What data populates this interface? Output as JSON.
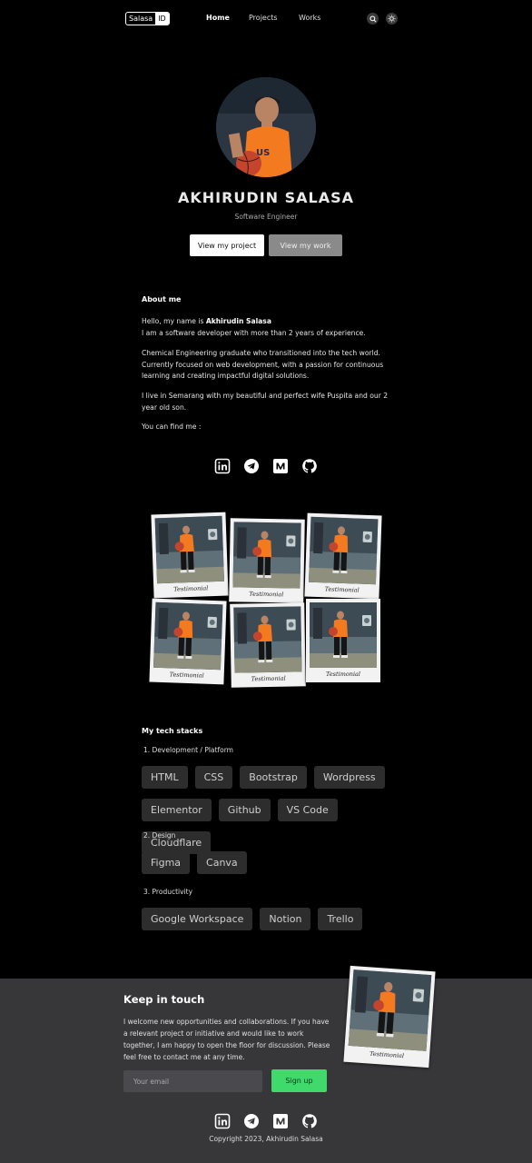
{
  "nav": {
    "logo_part1": "Salasa",
    "logo_part2": "ID",
    "links": [
      "Home",
      "Projects",
      "Works"
    ],
    "icons": [
      "search-icon",
      "sun-icon"
    ]
  },
  "hero": {
    "name": "AKHIRUDIN SALASA",
    "role": "Software Engineer",
    "primary_button": "View my project",
    "secondary_button": "View my work"
  },
  "about": {
    "heading": "About me",
    "greeting_prefix": "Hello, my name is ",
    "greeting_name": "Akhirudin Salasa",
    "line2": "I am a software developer with more than 2 years of experience.",
    "para2": "Chemical Engineering graduate who transitioned into the tech world. Currently focused on web development, with a passion for continuous learning and creating impactful digital solutions.",
    "para3": "I live in Semarang with my beautiful and perfect wife Puspita and our 2 year old son.",
    "para4": "You can find me :"
  },
  "socials": [
    "linkedin-icon",
    "telegram-icon",
    "medium-icon",
    "github-icon"
  ],
  "gallery": {
    "caption": "Testimonial",
    "count": 6
  },
  "tech": {
    "heading": "My tech stacks",
    "categories": [
      {
        "label": "1. Development / Platform",
        "items": [
          "HTML",
          "CSS",
          "Bootstrap",
          "Wordpress",
          "Elementor",
          "Github",
          "VS Code",
          "Cloudflare"
        ]
      },
      {
        "label": "2. Design",
        "items": [
          "Figma",
          "Canva"
        ]
      },
      {
        "label": "3. Productivity",
        "items": [
          "Google Workspace",
          "Notion",
          "Trello"
        ]
      }
    ]
  },
  "footer": {
    "title": "Keep in touch",
    "text": "I welcome new opportunities and collaborations. If you have a relevant project or initiative and would like to work together, I am happy to open the floor for discussion. Please feel free to contact me at any time.",
    "email_placeholder": "Your email",
    "signup_label": "Sign up",
    "polaroid_caption": "Testimonial",
    "copyright": "Copyright 2023, Akhirudin Salasa"
  },
  "colors": {
    "background": "#000000",
    "footer_bg": "#37373a",
    "signup_green": "#3fd96c",
    "chip_bg": "#2d2d2d",
    "jersey_orange": "#f47a20"
  }
}
